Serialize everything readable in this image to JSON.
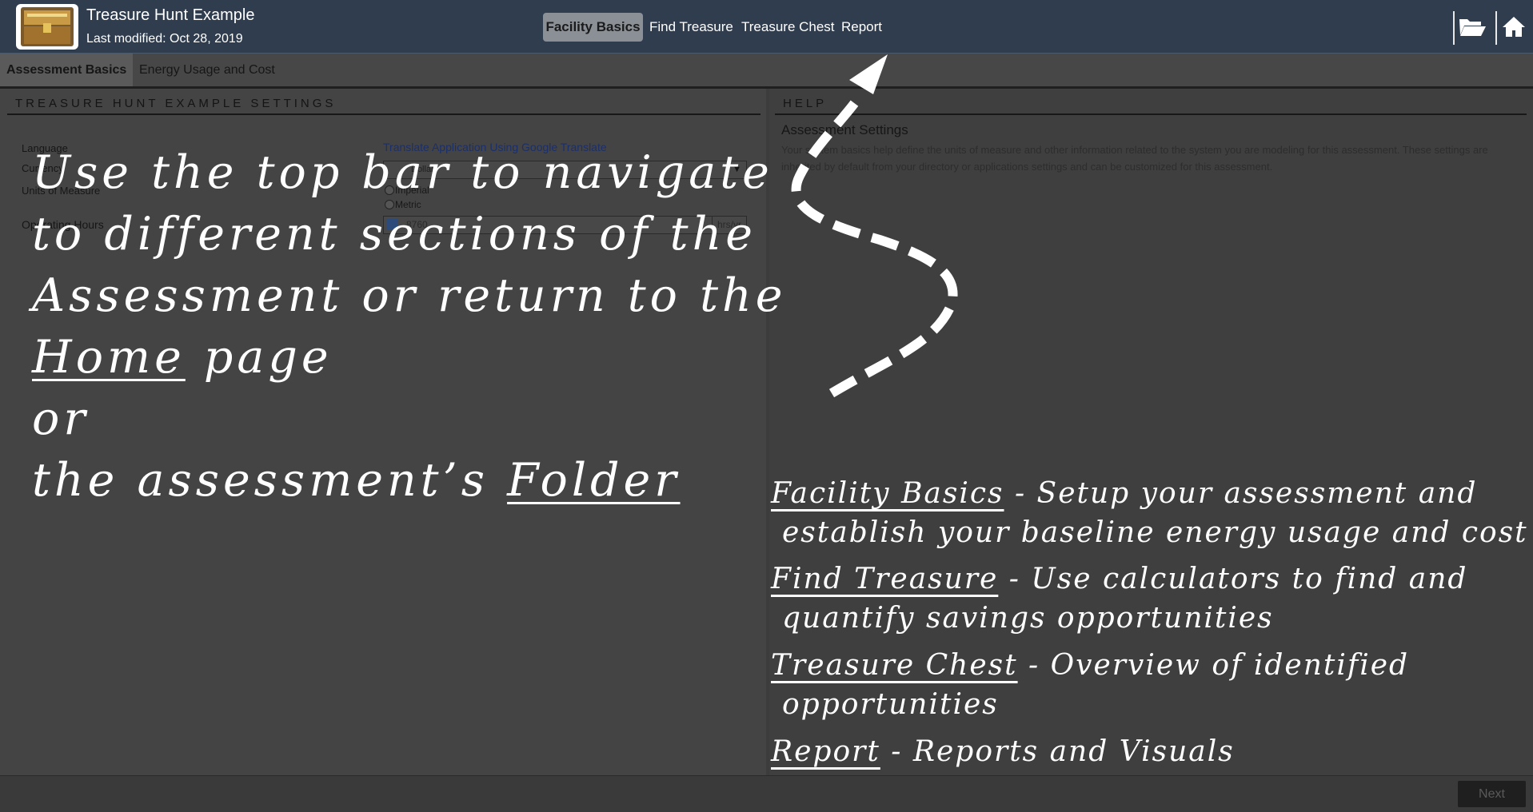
{
  "header": {
    "title": "Treasure Hunt Example",
    "modified": "Last modified: Oct 28, 2019",
    "nav": {
      "facility": "Facility Basics",
      "find": "Find Treasure",
      "chest": "Treasure Chest",
      "report": "Report"
    },
    "icons": [
      "folder-icon",
      "home-icon"
    ]
  },
  "subtabs": {
    "basics": "Assessment Basics",
    "energy": "Energy Usage and Cost"
  },
  "settings": {
    "heading": "TREASURE HUNT EXAMPLE SETTINGS",
    "language_label": "Language",
    "translate_link": "Translate Application Using Google Translate",
    "currency_label": "Currency",
    "currency_value": "Dollar",
    "units_label": "Units of Measure",
    "units_options": [
      "Imperial",
      "Metric"
    ],
    "hours_label": "Operating Hours",
    "hours_value": "8760",
    "hours_unit": "hrs/yr"
  },
  "help": {
    "heading": "HELP",
    "subtitle": "Assessment Settings",
    "body": "Your system basics help define the units of measure and other information related to the system you are modeling for this assessment. These settings are inherited by default from your directory or applications settings and can be customized for this assessment."
  },
  "overlay": {
    "left_lines": {
      "l1": "Use the top bar to navigate",
      "l2": "to different sections of the",
      "l3": "Assessment or return to the",
      "l4_link": "Home",
      "l4_rest": " page",
      "l5": "or",
      "l6_pre": "the assessment’s ",
      "l6_link": "Folder"
    },
    "definitions": {
      "facility_term": "Facility Basics",
      "facility_text": " - Setup your assessment and",
      "facility_text2": "establish your baseline energy usage and cost",
      "find_term": "Find Treasure",
      "find_text": " - Use calculators to find and",
      "find_text2": "quantify savings opportunities",
      "chest_term": "Treasure Chest",
      "chest_text": " - Overview of identified",
      "chest_text2": "opportunities",
      "report_term": "Report",
      "report_text": " - Reports and Visuals"
    }
  },
  "footer": {
    "next": "Next"
  },
  "colors": {
    "topbar": "#2f3d4f",
    "active_tab": "#8a9096",
    "overlay_text": "#ffffff"
  }
}
